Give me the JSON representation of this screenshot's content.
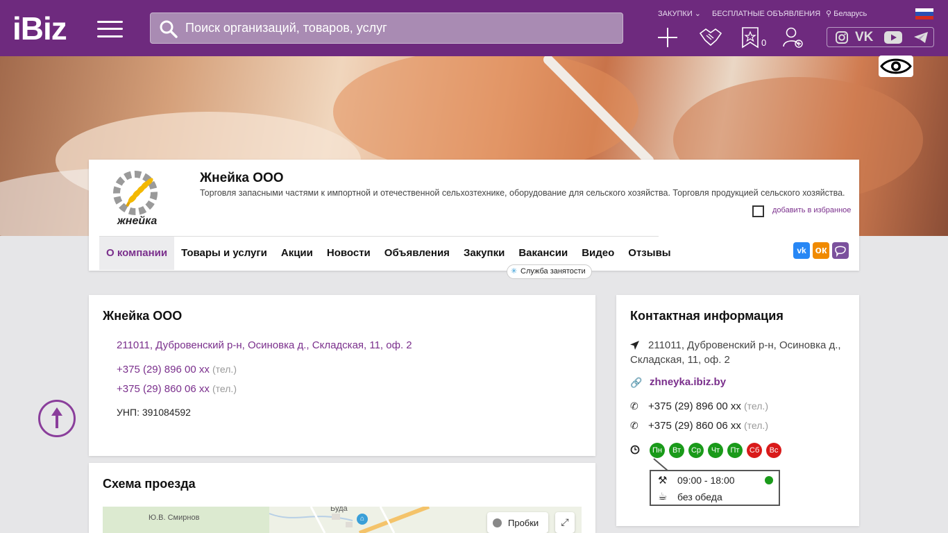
{
  "header": {
    "logo": "iBiz",
    "search_placeholder": "Поиск организаций, товаров, услуг",
    "links": {
      "purchases": "ЗАКУПКИ",
      "free_ads": "БЕСПЛАТНЫЕ ОБЪЯВЛЕНИЯ",
      "region": "Беларусь"
    },
    "favorites_count": "0",
    "flag_colors": [
      "#ffffff",
      "#2a4fb3",
      "#d52b1e"
    ]
  },
  "company": {
    "name": "Жнейка ООО",
    "logo_text": "жнейка",
    "description": "Торговля запасными частями к импортной и отечественной сельхозтехнике, оборудование для сельского хозяйства. Торговля продукцией сельского хозяйства.",
    "favorite_label": "добавить в избранное",
    "tabs": [
      "О компании",
      "Товары и услуги",
      "Акции",
      "Новости",
      "Объявления",
      "Закупки",
      "Вакансии",
      "Видео",
      "Отзывы"
    ],
    "active_tab": "О компании",
    "tooltip": "Служба занятости"
  },
  "about": {
    "title": "Жнейка ООО",
    "address": "211011, Дубровенский р-н, Осиновка д., Складская, 11, оф. 2",
    "phones": [
      {
        "number": "+375 (29) 896 00 xx",
        "type": "(тел.)"
      },
      {
        "number": "+375 (29) 860 06 xx",
        "type": "(тел.)"
      }
    ],
    "unp": "УНП: 391084592"
  },
  "contacts": {
    "title": "Контактная информация",
    "address_line1": "211011, Дубровенский р-н, Осиновка д.,",
    "address_line2": "Складская, 11, оф. 2",
    "website": "zhneyka.ibiz.by",
    "phones": [
      {
        "number": "+375 (29) 896 00 xx",
        "type": "(тел.)"
      },
      {
        "number": "+375 (29) 860 06 xx",
        "type": "(тел.)"
      }
    ],
    "days": [
      {
        "label": "Пн",
        "color": "#1a9a1a"
      },
      {
        "label": "Вт",
        "color": "#1a9a1a"
      },
      {
        "label": "Ср",
        "color": "#1a9a1a"
      },
      {
        "label": "Чт",
        "color": "#1a9a1a"
      },
      {
        "label": "Пт",
        "color": "#1a9a1a"
      },
      {
        "label": "Сб",
        "color": "#d91a1a"
      },
      {
        "label": "Вс",
        "color": "#d91a1a"
      }
    ],
    "hours": "09:00 - 18:00",
    "lunch": "без обеда"
  },
  "map": {
    "title": "Схема проезда",
    "traffic_label": "Пробки",
    "place1": "Ю.В. Смирнов",
    "place2": "Буда"
  },
  "colors": {
    "brand": "#6e2a7e",
    "accent": "#7a2f8c"
  }
}
